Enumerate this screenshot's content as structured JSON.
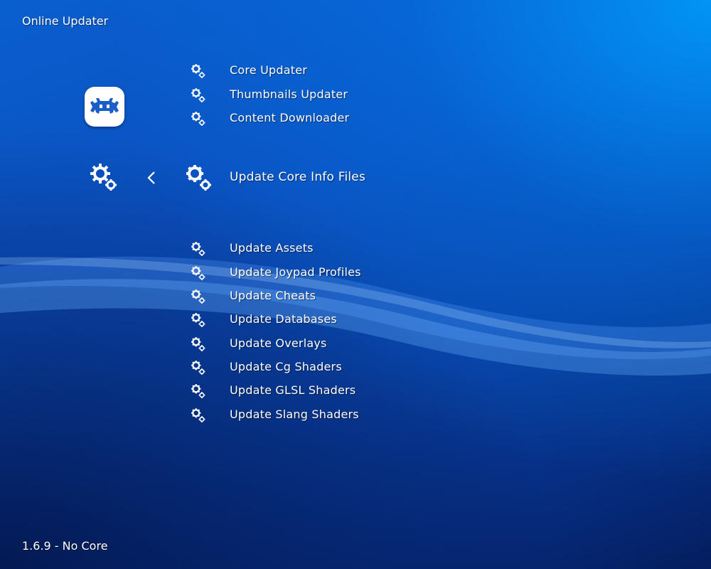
{
  "header": {
    "title": "Online Updater"
  },
  "footer": {
    "version": "1.6.9 - No Core"
  },
  "menu": {
    "items_top": [
      {
        "label": "Core Updater",
        "icon": "gear-icon"
      },
      {
        "label": "Thumbnails Updater",
        "icon": "gear-icon"
      },
      {
        "label": "Content Downloader",
        "icon": "gear-icon"
      }
    ],
    "selected": {
      "label": "Update Core Info Files",
      "icon": "gear-icon"
    },
    "items_bottom": [
      {
        "label": "Update Assets",
        "icon": "gear-icon"
      },
      {
        "label": "Update Joypad Profiles",
        "icon": "gear-icon"
      },
      {
        "label": "Update Cheats",
        "icon": "gear-icon"
      },
      {
        "label": "Update Databases",
        "icon": "gear-icon"
      },
      {
        "label": "Update Overlays",
        "icon": "gear-icon"
      },
      {
        "label": "Update Cg Shaders",
        "icon": "gear-icon"
      },
      {
        "label": "Update GLSL Shaders",
        "icon": "gear-icon"
      },
      {
        "label": "Update Slang Shaders",
        "icon": "gear-icon"
      }
    ]
  },
  "colors": {
    "accent": "#0b50c0",
    "text": "#ffffff",
    "logo": "#1a5fc8"
  }
}
